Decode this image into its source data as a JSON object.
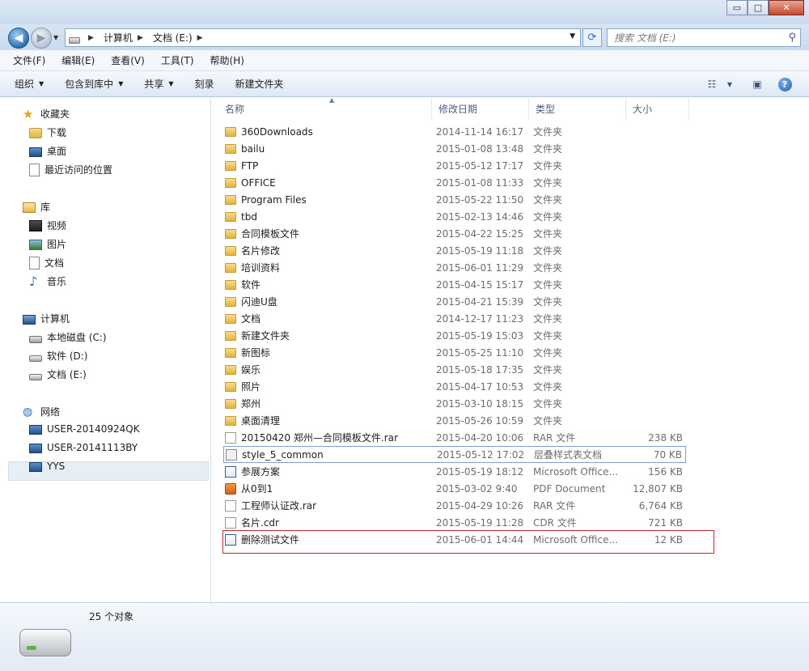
{
  "window": {
    "minimize_glyph": "▭",
    "maximize_glyph": "□",
    "close_glyph": "✕"
  },
  "address": {
    "crumbs": [
      "计算机",
      "文档 (E:)"
    ],
    "search_placeholder": "搜索 文档 (E:)"
  },
  "menu": [
    "文件(F)",
    "编辑(E)",
    "查看(V)",
    "工具(T)",
    "帮助(H)"
  ],
  "toolbar": {
    "organize": "组织",
    "include_library": "包含到库中",
    "share": "共享",
    "burn": "刻录",
    "new_folder": "新建文件夹"
  },
  "sidebar": {
    "favorites": {
      "label": "收藏夹",
      "items": [
        "下载",
        "桌面",
        "最近访问的位置"
      ]
    },
    "libraries": {
      "label": "库",
      "items": [
        "视频",
        "图片",
        "文档",
        "音乐"
      ]
    },
    "computer": {
      "label": "计算机",
      "items": [
        "本地磁盘 (C:)",
        "软件 (D:)",
        "文档 (E:)"
      ]
    },
    "network": {
      "label": "网络",
      "items": [
        "USER-20140924QK",
        "USER-20141113BY",
        "YYS"
      ]
    }
  },
  "columns": {
    "name": "名称",
    "date": "修改日期",
    "type": "类型",
    "size": "大小"
  },
  "files": [
    {
      "name": "360Downloads",
      "date": "2014-11-14 16:17",
      "type": "文件夹",
      "size": "",
      "icon": "folder"
    },
    {
      "name": "bailu",
      "date": "2015-01-08 13:48",
      "type": "文件夹",
      "size": "",
      "icon": "folder"
    },
    {
      "name": "FTP",
      "date": "2015-05-12 17:17",
      "type": "文件夹",
      "size": "",
      "icon": "folder"
    },
    {
      "name": "OFFICE",
      "date": "2015-01-08 11:33",
      "type": "文件夹",
      "size": "",
      "icon": "folder"
    },
    {
      "name": "Program Files",
      "date": "2015-05-22 11:50",
      "type": "文件夹",
      "size": "",
      "icon": "folder"
    },
    {
      "name": "tbd",
      "date": "2015-02-13 14:46",
      "type": "文件夹",
      "size": "",
      "icon": "folder"
    },
    {
      "name": "合同模板文件",
      "date": "2015-04-22 15:25",
      "type": "文件夹",
      "size": "",
      "icon": "folder"
    },
    {
      "name": "名片修改",
      "date": "2015-05-19 11:18",
      "type": "文件夹",
      "size": "",
      "icon": "folder"
    },
    {
      "name": "培训资料",
      "date": "2015-06-01 11:29",
      "type": "文件夹",
      "size": "",
      "icon": "folder"
    },
    {
      "name": "软件",
      "date": "2015-04-15 15:17",
      "type": "文件夹",
      "size": "",
      "icon": "folder"
    },
    {
      "name": "闪迪U盘",
      "date": "2015-04-21 15:39",
      "type": "文件夹",
      "size": "",
      "icon": "folder"
    },
    {
      "name": "文档",
      "date": "2014-12-17 11:23",
      "type": "文件夹",
      "size": "",
      "icon": "folder"
    },
    {
      "name": "新建文件夹",
      "date": "2015-05-19 15:03",
      "type": "文件夹",
      "size": "",
      "icon": "folder"
    },
    {
      "name": "新图标",
      "date": "2015-05-25 11:10",
      "type": "文件夹",
      "size": "",
      "icon": "folder"
    },
    {
      "name": "娱乐",
      "date": "2015-05-18 17:35",
      "type": "文件夹",
      "size": "",
      "icon": "folder"
    },
    {
      "name": "照片",
      "date": "2015-04-17 10:53",
      "type": "文件夹",
      "size": "",
      "icon": "folder"
    },
    {
      "name": "郑州",
      "date": "2015-03-10 18:15",
      "type": "文件夹",
      "size": "",
      "icon": "folder"
    },
    {
      "name": "桌面清理",
      "date": "2015-05-26 10:59",
      "type": "文件夹",
      "size": "",
      "icon": "folder"
    },
    {
      "name": "20150420 郑州—合同模板文件.rar",
      "date": "2015-04-20 10:06",
      "type": "RAR 文件",
      "size": "238 KB",
      "icon": "rar"
    },
    {
      "name": "style_5_common",
      "date": "2015-05-12 17:02",
      "type": "层叠样式表文档",
      "size": "70 KB",
      "icon": "css"
    },
    {
      "name": "参展方案",
      "date": "2015-05-19 18:12",
      "type": "Microsoft Office...",
      "size": "156 KB",
      "icon": "word"
    },
    {
      "name": "从0到1",
      "date": "2015-03-02 9:40",
      "type": "PDF Document",
      "size": "12,807 KB",
      "icon": "pdf"
    },
    {
      "name": "工程师认证改.rar",
      "date": "2015-04-29 10:26",
      "type": "RAR 文件",
      "size": "6,764 KB",
      "icon": "rar"
    },
    {
      "name": "名片.cdr",
      "date": "2015-05-19 11:28",
      "type": "CDR 文件",
      "size": "721 KB",
      "icon": "cdr"
    },
    {
      "name": "删除测试文件",
      "date": "2015-06-01 14:44",
      "type": "Microsoft Office...",
      "size": "12 KB",
      "icon": "word"
    }
  ],
  "status": {
    "count": "25 个对象"
  }
}
